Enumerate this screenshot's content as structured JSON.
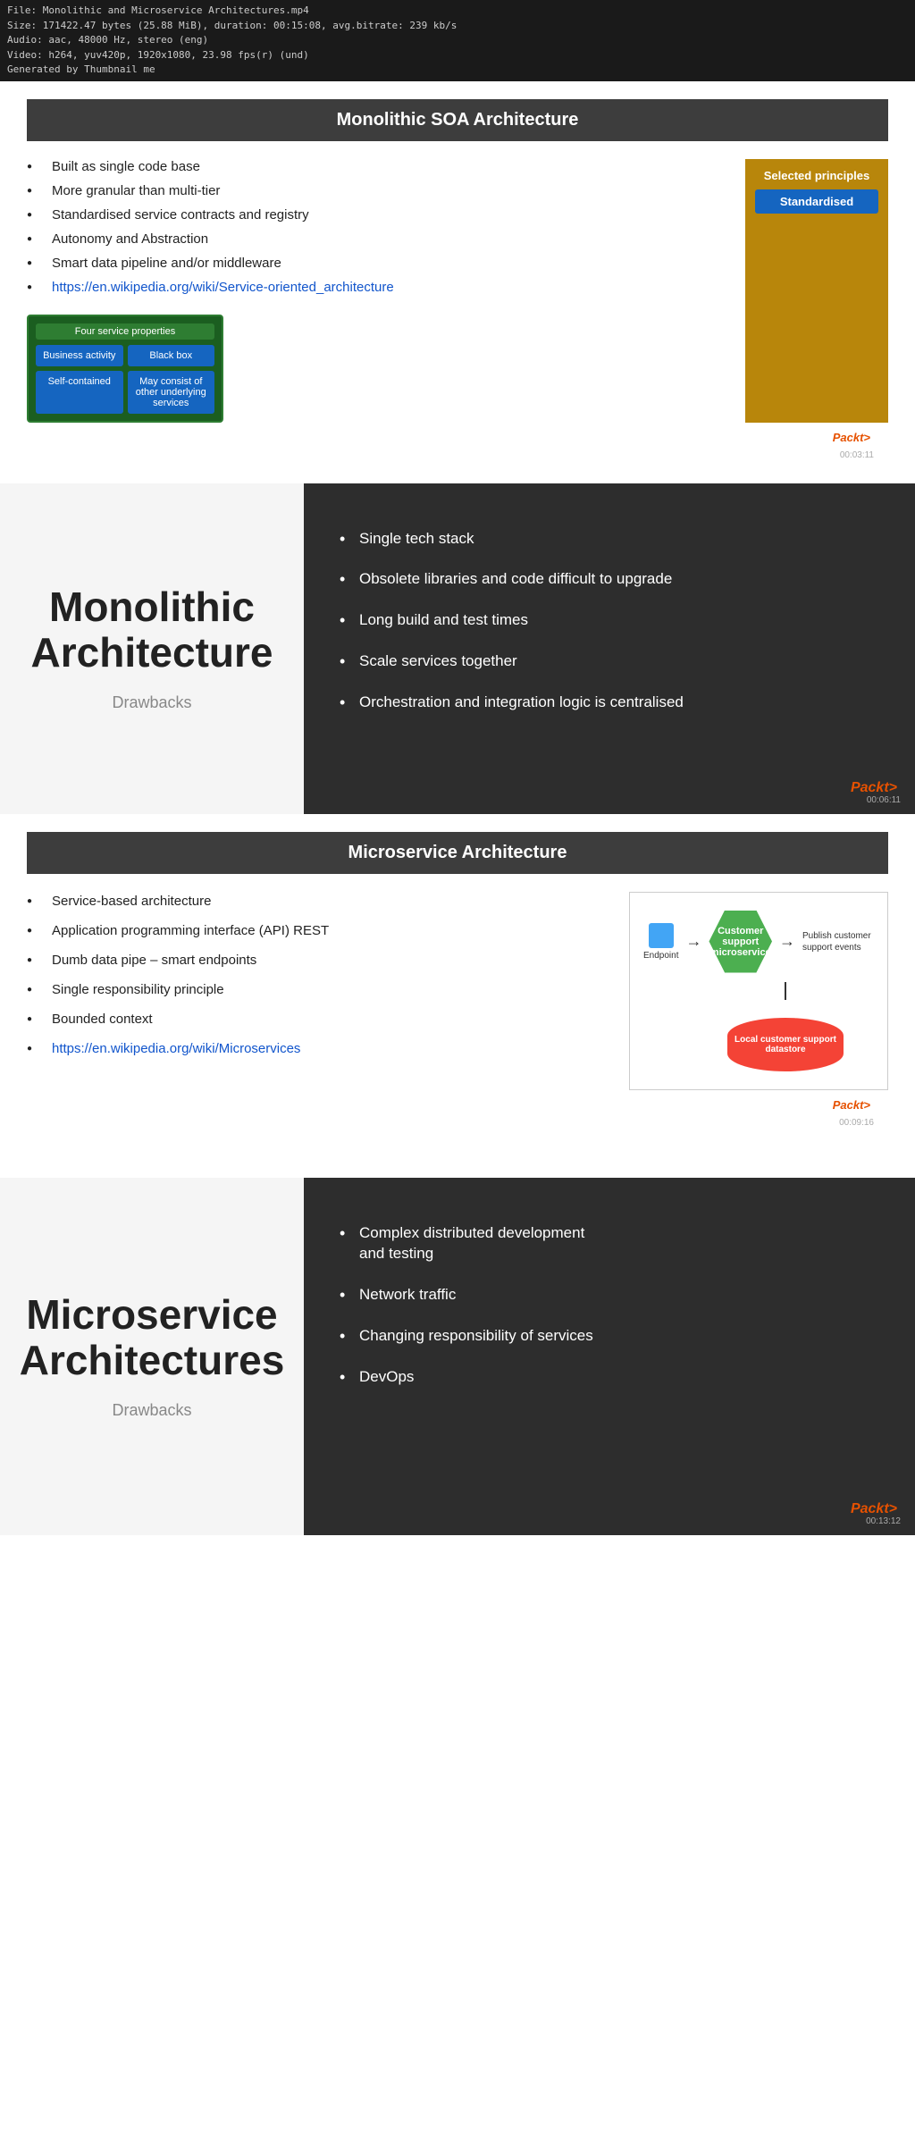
{
  "fileInfo": {
    "line1": "File: Monolithic and Microservice Architectures.mp4",
    "line2": "Size: 171422.47 bytes (25.88 MiB), duration: 00:15:08, avg.bitrate: 239 kb/s",
    "line3": "Audio: aac, 48000 Hz, stereo (eng)",
    "line4": "Video: h264, yuv420p, 1920x1080, 23.98 fps(r) (und)",
    "line5": "Generated by Thumbnail me"
  },
  "soa": {
    "header": "Monolithic SOA Architecture",
    "bullets": [
      "Built as single code base",
      "More granular than multi-tier",
      "Standardised service contracts and registry",
      "Autonomy and Abstraction",
      "Smart data pipeline and/or middleware"
    ],
    "link": "https://en.wikipedia.org/wiki/Service-oriented_architecture",
    "diagram": {
      "title": "Four service properties",
      "cells": [
        "Business activity",
        "Black box",
        "Self-contained",
        "May consist of other underlying services"
      ]
    },
    "principles": {
      "title": "Selected principles",
      "button": "Standardised"
    },
    "packt": "Packt>",
    "timestamp": "00:03:11"
  },
  "monoDrawbacks": {
    "title": "Monolithic\nArchitecture",
    "subtitle": "Drawbacks",
    "bullets": [
      "Single tech stack",
      "Obsolete libraries and code difficult to upgrade",
      "Long build and test times",
      "Scale services together",
      "Orchestration and integration logic is centralised"
    ],
    "packt": "Packt>",
    "timestamp": "00:06:11"
  },
  "microservice": {
    "header": "Microservice Architecture",
    "bullets": [
      "Service-based architecture",
      "Application programming interface (API) REST",
      "Dumb data pipe – smart endpoints",
      "Single responsibility principle",
      "Bounded context"
    ],
    "link": "https://en.wikipedia.org/wiki/Microservices",
    "diagram": {
      "endpoint": "Endpoint",
      "hexLabel": "Customer support\nmicroservice",
      "publishText": "Publish customer support events",
      "datastoreLabel": "Local customer support\ndatastore"
    },
    "packt": "Packt>",
    "timestamp": "00:09:16"
  },
  "msDrawbacks": {
    "title": "Microservice\nArchitectures",
    "subtitle": "Drawbacks",
    "bullets": [
      "Complex distributed development\nand testing",
      "Network traffic",
      "Changing responsibility of services",
      "DevOps"
    ],
    "packt": "Packt>",
    "timestamp": "00:13:12"
  }
}
